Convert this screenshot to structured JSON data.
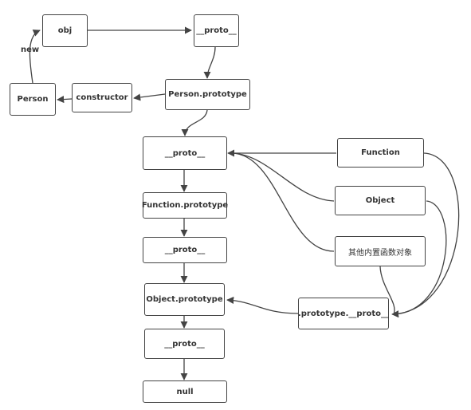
{
  "diagram": {
    "type": "prototype-chain flowchart",
    "nodes": {
      "obj": "obj",
      "proto_top": "__proto__",
      "person": "Person",
      "constructor": "constructor",
      "person_prototype": "Person.prototype",
      "proto_fn": "__proto__",
      "function_prototype": "Function.prototype",
      "proto_mid": "__proto__",
      "object_prototype": "Object.prototype",
      "proto_bottom": "__proto__",
      "null": "null",
      "function": "Function",
      "object": "Object",
      "builtin": "其他内置函数对象",
      "prototype_proto": ".prototype.__proto__"
    },
    "edge_labels": {
      "person_to_obj": "new"
    },
    "edges": [
      {
        "from": "person",
        "to": "obj",
        "label": "new"
      },
      {
        "from": "obj",
        "to": "proto_top"
      },
      {
        "from": "proto_top",
        "to": "person_prototype"
      },
      {
        "from": "person_prototype",
        "to": "constructor"
      },
      {
        "from": "constructor",
        "to": "person"
      },
      {
        "from": "person_prototype",
        "to": "proto_fn"
      },
      {
        "from": "proto_fn",
        "to": "function_prototype"
      },
      {
        "from": "function_prototype",
        "to": "proto_mid"
      },
      {
        "from": "proto_mid",
        "to": "object_prototype"
      },
      {
        "from": "object_prototype",
        "to": "proto_bottom"
      },
      {
        "from": "proto_bottom",
        "to": "null"
      },
      {
        "from": "function",
        "to": "proto_fn"
      },
      {
        "from": "object",
        "to": "proto_fn"
      },
      {
        "from": "builtin",
        "to": "proto_fn"
      },
      {
        "from": "function",
        "to": "prototype_proto"
      },
      {
        "from": "object",
        "to": "prototype_proto"
      },
      {
        "from": "builtin",
        "to": "prototype_proto"
      },
      {
        "from": "prototype_proto",
        "to": "object_prototype"
      }
    ]
  }
}
